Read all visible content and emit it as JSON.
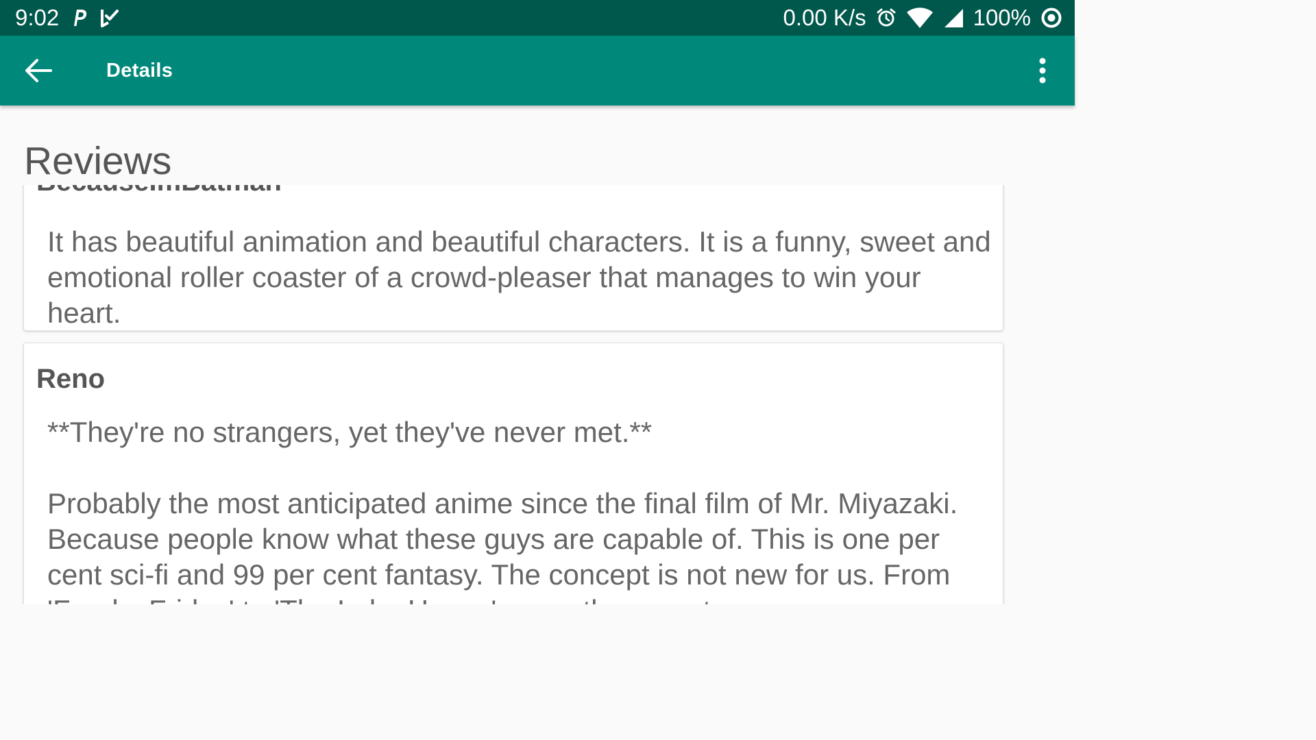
{
  "status_bar": {
    "time": "9:02",
    "network_speed": "0.00 K/s",
    "battery": "100%",
    "icons": [
      "p-notification-icon",
      "checkmark-notification-icon",
      "alarm-icon",
      "wifi-icon",
      "cell-signal-icon",
      "battery-ring-icon"
    ],
    "background_color": "#00574b"
  },
  "app_bar": {
    "title": "Details",
    "back_icon": "arrow-back-icon",
    "menu_icon": "more-vert-icon",
    "background_color": "#00897b"
  },
  "section": {
    "title": "Reviews"
  },
  "reviews": [
    {
      "author": "BecauseImBatman",
      "content": "It has beautiful animation and beautiful characters. It is a funny, sweet and emotional roller coaster of a crowd-pleaser that manages to win your heart."
    },
    {
      "author": "Reno",
      "content": "**They're no strangers, yet they've never met.**\n\nProbably the most anticipated anime since the final film of Mr. Miyazaki. Because people know what these guys are capable of. This is one per cent sci-fi and 99 per cent fantasy. The concept is not new for us. From 'Freaky Friday' to 'The Lake House', even the recent"
    }
  ]
}
